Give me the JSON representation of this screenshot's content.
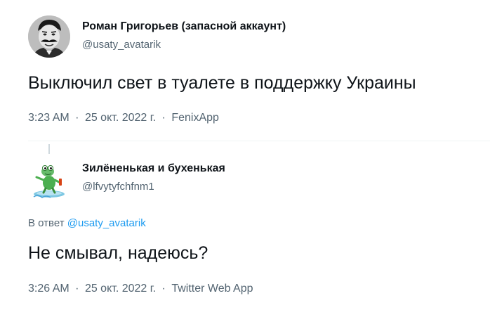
{
  "tweet1": {
    "display_name": "Роман Григорьев (запасной аккаунт)",
    "handle": "@usaty_avatarik",
    "text": "Выключил свет в туалете в поддержку Украины",
    "time": "3:23 AM",
    "date": "25 окт. 2022 г.",
    "source": "FenixApp",
    "separator": "·"
  },
  "tweet2": {
    "display_name": "Зилёненькая и бухенькая",
    "handle": "@lfvytyfchfnm1",
    "reply_prefix": "В ответ",
    "reply_mention": "@usaty_avatarik",
    "text": "Не смывал, надеюсь?",
    "time": "3:26 AM",
    "date": "25 окт. 2022 г.",
    "source": "Twitter Web App",
    "separator": "·"
  },
  "colors": {
    "text_primary": "#0f1419",
    "text_secondary": "#536471",
    "link": "#1d9bf0",
    "divider": "#eff3f4"
  },
  "icons": {
    "avatar1": "mustache-man-avatar",
    "avatar2": "frog-on-surfboard-avatar"
  }
}
